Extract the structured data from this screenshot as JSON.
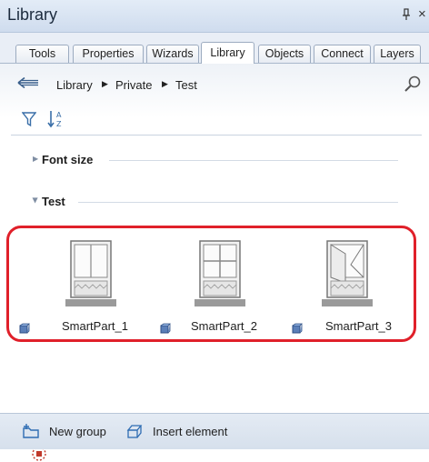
{
  "window": {
    "title": "Library",
    "pin_glyph": "ꟷ",
    "close_glyph": "×"
  },
  "tabs": [
    {
      "label": "Tools"
    },
    {
      "label": "Properties"
    },
    {
      "label": "Wizards"
    },
    {
      "label": "Library",
      "active": true
    },
    {
      "label": "Objects"
    },
    {
      "label": "Connect"
    },
    {
      "label": "Layers"
    }
  ],
  "breadcrumb": [
    "Library",
    "Private",
    "Test"
  ],
  "groups": [
    {
      "label": "Font size",
      "expanded": false
    },
    {
      "label": "Test",
      "expanded": true
    }
  ],
  "items": [
    {
      "label": "SmartPart_1",
      "icon": "window-double-hung-icon"
    },
    {
      "label": "SmartPart_2",
      "icon": "window-four-pane-icon"
    },
    {
      "label": "SmartPart_3",
      "icon": "window-open-sash-icon"
    }
  ],
  "bottom_bar": {
    "new_group_label": "New group",
    "insert_element_label": "Insert element"
  },
  "colors": {
    "highlight_frame": "#e0202a",
    "accent": "#2f6db3"
  }
}
